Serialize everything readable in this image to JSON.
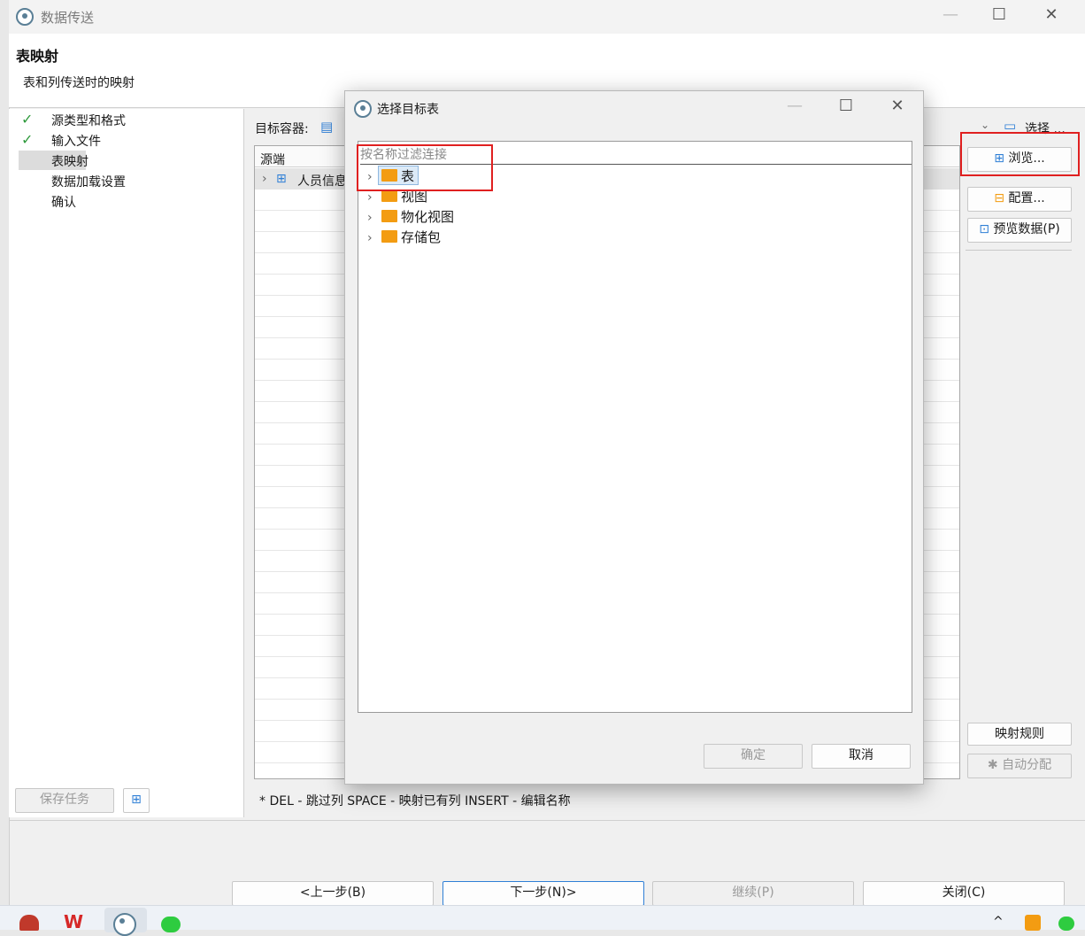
{
  "window": {
    "title": "数据传送"
  },
  "header": {
    "title": "表映射",
    "subtitle": "表和列传送时的映射"
  },
  "steps": [
    {
      "label": "源类型和格式",
      "done": true
    },
    {
      "label": "输入文件",
      "done": true
    },
    {
      "label": "表映射",
      "active": true
    },
    {
      "label": "数据加载设置"
    },
    {
      "label": "确认"
    }
  ],
  "left_buttons": {
    "save_task": "保存任务"
  },
  "target": {
    "label": "目标容器:",
    "select_button": "选择 ..."
  },
  "grid": {
    "col_source": "源端",
    "rows": [
      {
        "name": "人员信息"
      }
    ]
  },
  "right_buttons": {
    "browse": "浏览...",
    "configure": "配置...",
    "preview": "预览数据(P)",
    "mapping_rules": "映射规则",
    "auto_assign": "自动分配"
  },
  "hint": "* DEL - 跳过列  SPACE - 映射已有列  INSERT - 编辑名称",
  "nav": {
    "prev": "<上一步(B)",
    "next": "下一步(N)>",
    "continue": "继续(P)",
    "close": "关闭(C)"
  },
  "dialog": {
    "title": "选择目标表",
    "filter_placeholder": "按名称过滤连接",
    "tree": [
      {
        "label": "表",
        "icon": "table-folder-icon"
      },
      {
        "label": "视图",
        "icon": "view-icon"
      },
      {
        "label": "物化视图",
        "icon": "view-icon"
      },
      {
        "label": "存储包",
        "icon": "folder-icon"
      }
    ],
    "ok": "确定",
    "cancel": "取消"
  },
  "colors": {
    "highlight_box": "#e02020",
    "accent": "#2f7fd6"
  }
}
